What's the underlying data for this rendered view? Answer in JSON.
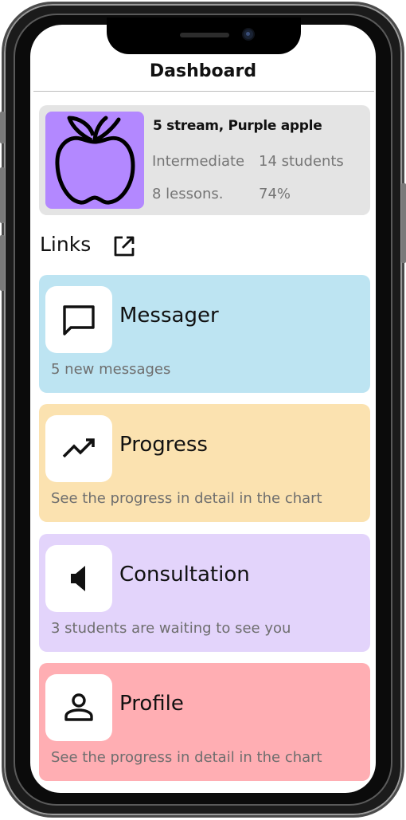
{
  "header": {
    "title": "Dashboard"
  },
  "course": {
    "name": "5 stream, Purple apple",
    "level": "Intermediate",
    "students": "14 students",
    "lessons": "8 lessons.",
    "progress": "74%",
    "image_icon": "apple-icon",
    "image_color": "#b388ff"
  },
  "links": {
    "title": "Links",
    "icon": "open-in-new-icon",
    "items": [
      {
        "title": "Messager",
        "subtitle": "5 new messages",
        "icon": "chat-bubble-icon",
        "color": "#bde4f2"
      },
      {
        "title": "Progress",
        "subtitle": "See the progress in detail in the chart",
        "icon": "trending-up-icon",
        "color": "#fbe2b0"
      },
      {
        "title": "Consultation",
        "subtitle": "3 students are waiting to see you",
        "icon": "speaker-icon",
        "color": "#e3d4fb"
      },
      {
        "title": "Profile",
        "subtitle": "See the progress in detail in the chart",
        "icon": "person-icon",
        "color": "#ffaeb3"
      }
    ]
  }
}
